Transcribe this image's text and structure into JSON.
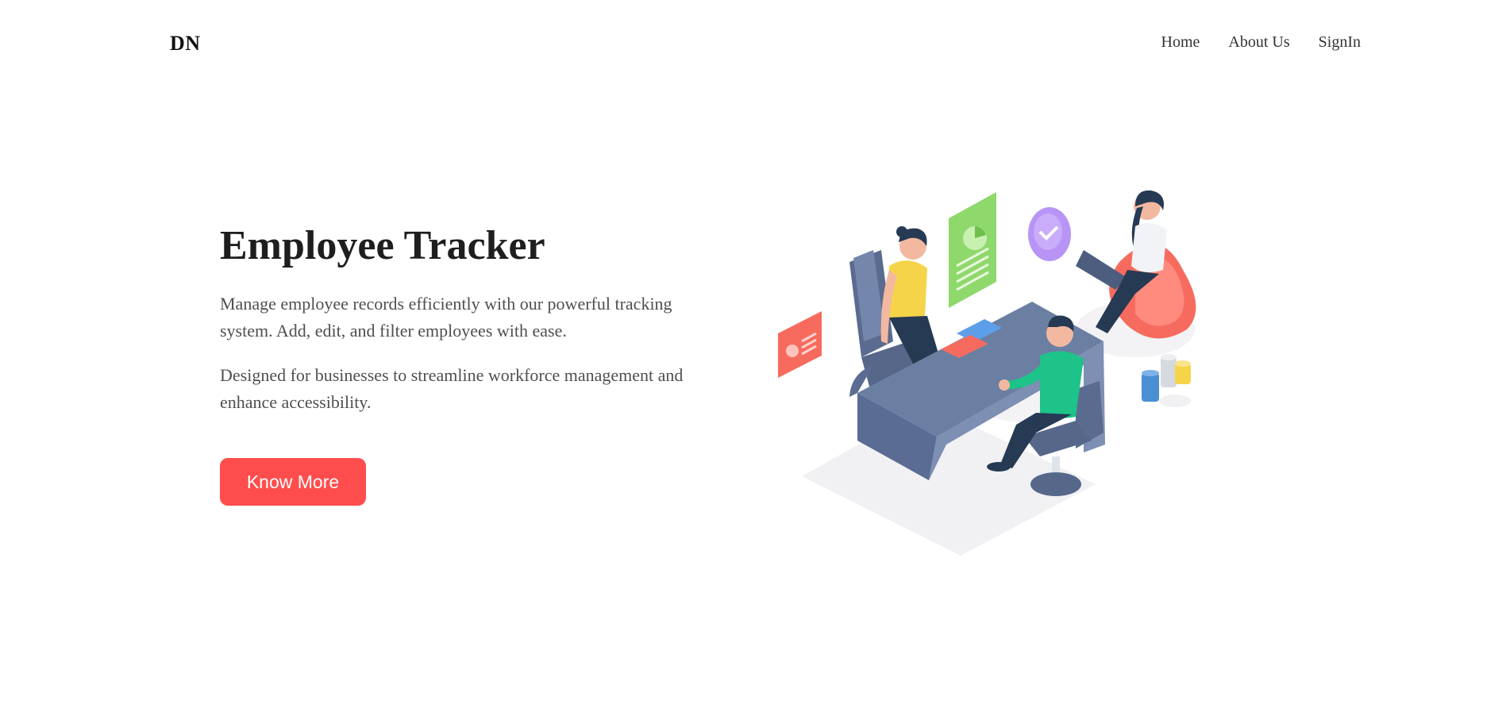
{
  "nav": {
    "logo": "DN",
    "links": [
      {
        "label": "Home"
      },
      {
        "label": "About Us"
      },
      {
        "label": "SignIn"
      }
    ]
  },
  "hero": {
    "title": "Employee Tracker",
    "paragraphs": [
      "Manage employee records efficiently with our powerful tracking system. Add, edit, and filter employees with ease.",
      "Designed for businesses to streamline workforce management and enhance accessibility."
    ],
    "cta_label": "Know More"
  },
  "colors": {
    "accent": "#ff4d4d",
    "desk": "#6b7fa3",
    "green_card": "#8fd86c",
    "purple_badge": "#b794f6",
    "coral": "#f76b5f",
    "yellow_shirt": "#f6d44a",
    "green_shirt": "#1dc389"
  }
}
